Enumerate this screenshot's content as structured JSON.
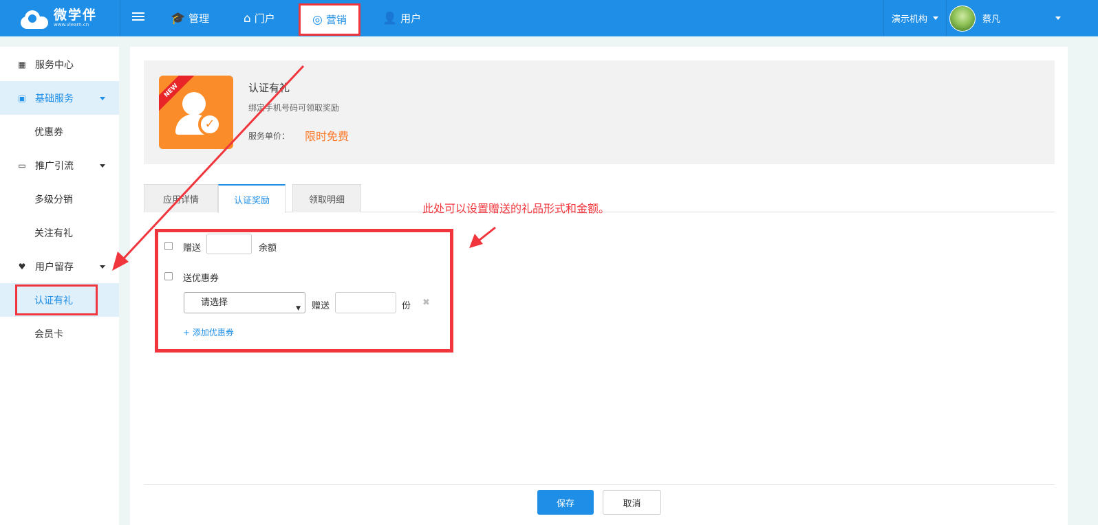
{
  "header": {
    "logo_text": "微学伴",
    "logo_sub": "www.vlearn.cn",
    "nav": [
      {
        "label": "管理",
        "icon": "graduation-cap-icon"
      },
      {
        "label": "门户",
        "icon": "home-icon"
      },
      {
        "label": "营销",
        "icon": "globe-icon"
      },
      {
        "label": "用户",
        "icon": "user-add-icon"
      }
    ],
    "org": "演示机构",
    "username": "蔡凡"
  },
  "sidebar": {
    "items": [
      {
        "label": "服务中心"
      },
      {
        "label": "基础服务"
      },
      {
        "label": "优惠券"
      },
      {
        "label": "推广引流"
      },
      {
        "label": "多级分销"
      },
      {
        "label": "关注有礼"
      },
      {
        "label": "用户留存"
      },
      {
        "label": "认证有礼"
      },
      {
        "label": "会员卡"
      }
    ]
  },
  "app": {
    "badge": "NEW",
    "title": "认证有礼",
    "desc": "绑定手机号码可领取奖励",
    "price_label": "服务单价：",
    "price_value": "限时免费"
  },
  "tabs": [
    {
      "label": "应用详情"
    },
    {
      "label": "认证奖励"
    },
    {
      "label": "领取明细"
    }
  ],
  "annotation": "此处可以设置赠送的礼品形式和金额。",
  "form": {
    "gift_label": "赠送",
    "balance_unit": "余额",
    "coupon_label": "送优惠券",
    "select_placeholder": "请选择",
    "gift_label_2": "赠送",
    "qty_unit": "份",
    "add_coupon": "+ 添加优惠券"
  },
  "footer": {
    "save": "保存",
    "cancel": "取消"
  },
  "colors": {
    "brand_blue": "#1e8ee6",
    "annotation_red": "#f0353c",
    "price_orange": "#fb7a2a"
  }
}
